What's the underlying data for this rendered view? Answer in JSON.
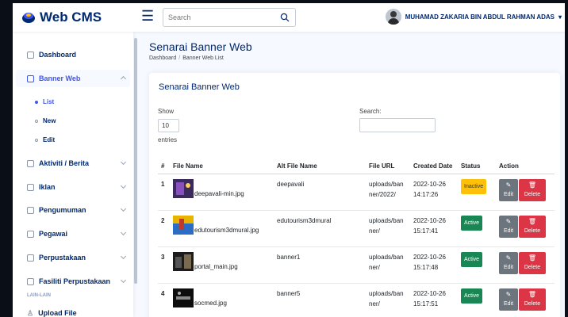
{
  "header": {
    "logo_text": "Web CMS",
    "search_placeholder": "Search",
    "user_name": "MUHAMAD ZAKARIA BIN ABDUL RAHMAN ADAS"
  },
  "sidebar": {
    "items": [
      {
        "label": "Dashboard"
      },
      {
        "label": "Banner Web"
      },
      {
        "label": "Aktiviti / Berita"
      },
      {
        "label": "Iklan"
      },
      {
        "label": "Pengumuman"
      },
      {
        "label": "Pegawai"
      },
      {
        "label": "Perpustakaan"
      },
      {
        "label": "Fasiliti Perpustakaan"
      }
    ],
    "sub_items": [
      {
        "label": "List"
      },
      {
        "label": "New"
      },
      {
        "label": "Edit"
      }
    ],
    "heading": "LAIN-LAIN",
    "upload_label": "Upload File"
  },
  "page": {
    "title": "Senarai Banner Web",
    "breadcrumb": [
      "Dashboard",
      "Banner Web List"
    ]
  },
  "card": {
    "title": "Senarai Banner Web",
    "show_label": "Show",
    "show_value": "10",
    "entries_label": "entries",
    "search_label": "Search:"
  },
  "table": {
    "columns": [
      "#",
      "File Name",
      "Alt File Name",
      "File URL",
      "Created Date",
      "Status",
      "Action"
    ],
    "rows": [
      {
        "num": "1",
        "file": "deepavali-min.jpg",
        "alt": "deepavali",
        "url": "uploads/banner/2022/",
        "date": "2022-10-26 14:17:26",
        "status": "Inactive",
        "edit": "Edit",
        "delete": "Delete"
      },
      {
        "num": "2",
        "file": "edutourism3dmural.jpg",
        "alt": "edutourism3dmural",
        "url": "uploads/banner/",
        "date": "2022-10-26 15:17:41",
        "status": "Active",
        "edit": "Edit",
        "delete": "Delete"
      },
      {
        "num": "3",
        "file": "portal_main.jpg",
        "alt": "banner1",
        "url": "uploads/banner/",
        "date": "2022-10-26 15:17:48",
        "status": "Active",
        "edit": "Edit",
        "delete": "Delete"
      },
      {
        "num": "4",
        "file": "socmed.jpg",
        "alt": "banner5",
        "url": "uploads/banner/",
        "date": "2022-10-26 15:17:51",
        "status": "Active",
        "edit": "Edit",
        "delete": "Delete"
      }
    ]
  },
  "colors": {
    "brand": "#012970",
    "accent": "#4154f1",
    "active": "#198754",
    "inactive": "#ffc107",
    "danger": "#dc3545",
    "secondary": "#6c757d"
  }
}
